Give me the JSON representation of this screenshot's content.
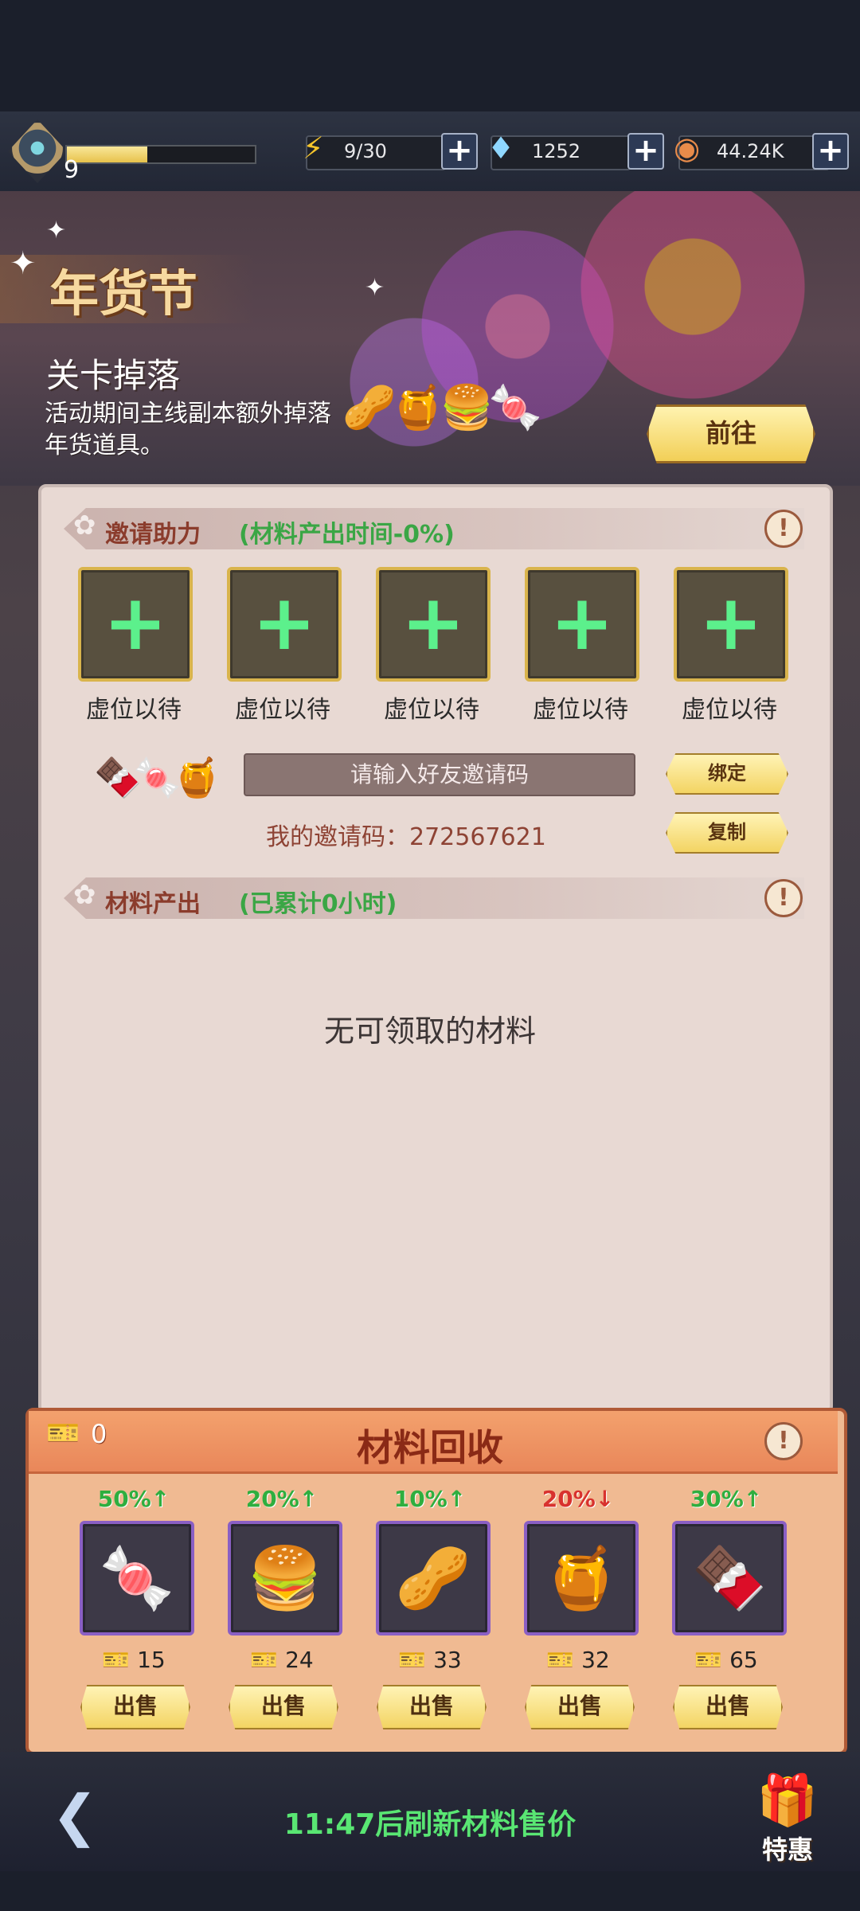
{
  "status_bar": {
    "level": "9",
    "xp_progress": 0.43,
    "energy": {
      "icon": "lightning-icon",
      "value": "9/30"
    },
    "gems": {
      "icon": "diamond-icon",
      "value": "1252"
    },
    "coins": {
      "icon": "coin-icon",
      "value": "44.24K"
    }
  },
  "banner": {
    "festival_title": "年货节",
    "drop_title": "关卡掉落",
    "drop_desc": "活动期间主线副本额外掉落年货道具。",
    "goto_label": "前往"
  },
  "invite": {
    "section_title": "邀请助力",
    "section_note": "(材料产出时间-0%)",
    "slots": [
      {
        "label": "虚位以待"
      },
      {
        "label": "虚位以待"
      },
      {
        "label": "虚位以待"
      },
      {
        "label": "虚位以待"
      },
      {
        "label": "虚位以待"
      }
    ],
    "code_placeholder": "请输入好友邀请码",
    "my_code": "我的邀请码：272567621",
    "bind_label": "绑定",
    "copy_label": "复制"
  },
  "output": {
    "section_title": "材料产出",
    "section_note": "(已累计0小时)",
    "empty_message": "无可领取的材料"
  },
  "recycle": {
    "title": "材料回收",
    "ticket_count": "0",
    "items": [
      {
        "name": "candy",
        "icon": "🍬",
        "change": "50%↑",
        "trend": "up",
        "price": "15",
        "sell_label": "出售"
      },
      {
        "name": "macaron",
        "icon": "🍔",
        "change": "20%↑",
        "trend": "up",
        "price": "24",
        "sell_label": "出售"
      },
      {
        "name": "almond",
        "icon": "🥜",
        "change": "10%↑",
        "trend": "up",
        "price": "33",
        "sell_label": "出售"
      },
      {
        "name": "honeycomb",
        "icon": "🍯",
        "change": "20%↓",
        "trend": "down",
        "price": "32",
        "sell_label": "出售"
      },
      {
        "name": "chocolate",
        "icon": "🍫",
        "change": "30%↑",
        "trend": "up",
        "price": "65",
        "sell_label": "出售"
      }
    ]
  },
  "footer": {
    "refresh_text": "11:47后刷新材料售价",
    "special_label": "特惠"
  },
  "colors": {
    "up": "#2fae3f",
    "down": "#d8322e",
    "accent_gold": "#f2cf57"
  }
}
